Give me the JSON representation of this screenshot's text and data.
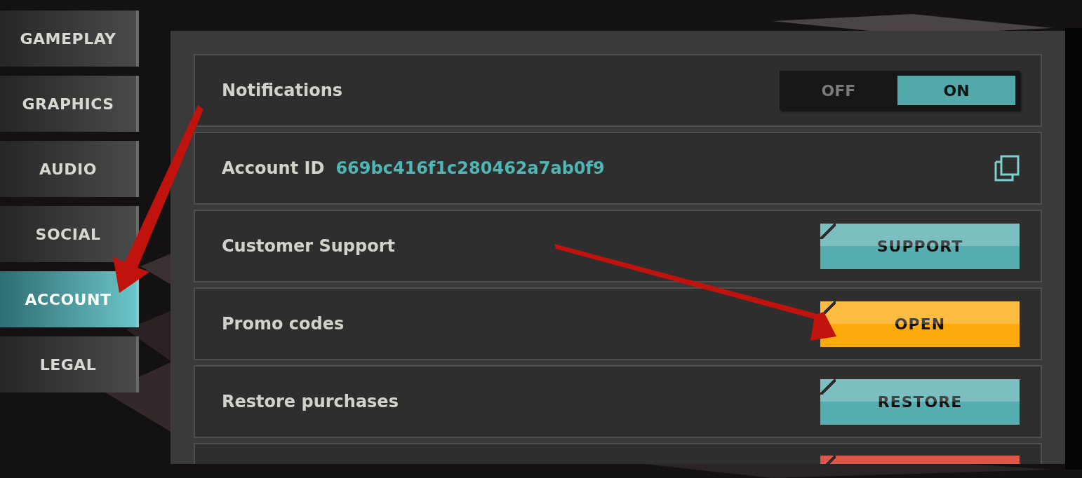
{
  "tabs": [
    {
      "label": "GAMEPLAY",
      "selected": false
    },
    {
      "label": "GRAPHICS",
      "selected": false
    },
    {
      "label": "AUDIO",
      "selected": false
    },
    {
      "label": "SOCIAL",
      "selected": false
    },
    {
      "label": "ACCOUNT",
      "selected": true
    },
    {
      "label": "LEGAL",
      "selected": false
    }
  ],
  "rows": [
    {
      "kind": "toggle",
      "label": "Notifications",
      "options": [
        {
          "label": "OFF",
          "selected": false
        },
        {
          "label": "ON",
          "selected": true
        }
      ]
    },
    {
      "kind": "id",
      "label": "Account ID",
      "value": "669bc416f1c280462a7ab0f9"
    },
    {
      "kind": "button",
      "label": "Customer Support",
      "button": {
        "label": "SUPPORT",
        "color": "#57aeb0"
      }
    },
    {
      "kind": "button",
      "label": "Promo codes",
      "button": {
        "label": "OPEN",
        "color": "#fcaa0c"
      }
    },
    {
      "kind": "button",
      "label": "Restore purchases",
      "button": {
        "label": "RESTORE",
        "color": "#57aeb0"
      }
    },
    {
      "kind": "button",
      "button": {
        "color": "#e0554a"
      }
    }
  ]
}
